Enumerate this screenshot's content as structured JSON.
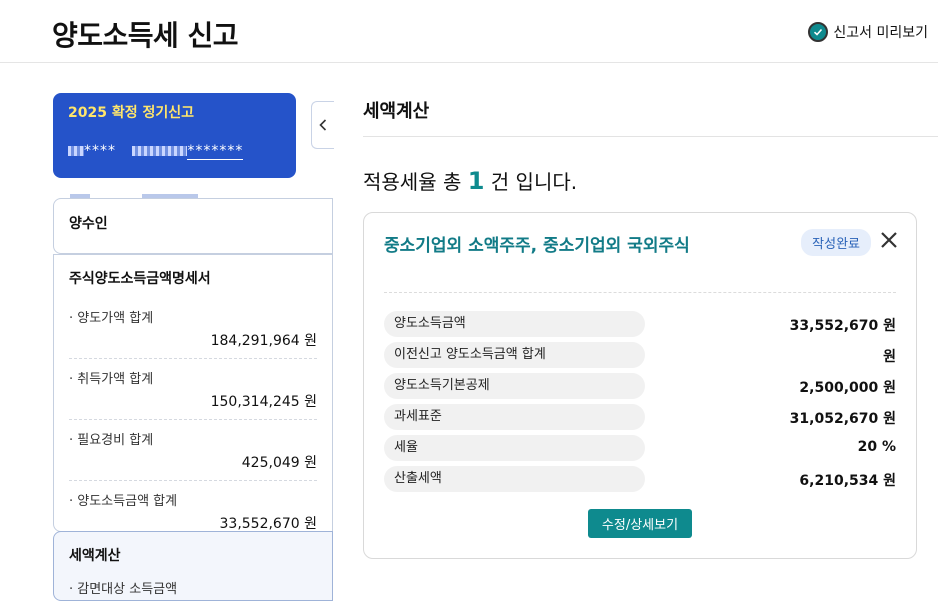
{
  "header": {
    "title": "양도소득세 신고",
    "preview_label": "신고서 미리보기"
  },
  "sidebar": {
    "card": {
      "year_label": "2025 확정 정기신고",
      "masked_left": "****",
      "masked_right": "*******"
    },
    "sections": [
      {
        "title": "양수인"
      },
      {
        "title": "주식양도소득금액명세서",
        "items": [
          {
            "label": "· 양도가액 합계",
            "value": "184,291,964 원"
          },
          {
            "label": "· 취득가액 합계",
            "value": "150,314,245 원"
          },
          {
            "label": "· 필요경비 합계",
            "value": "425,049 원"
          },
          {
            "label": "· 양도소득금액 합계",
            "value": "33,552,670 원"
          }
        ]
      },
      {
        "title": "세액계산",
        "items": [
          {
            "label": "· 감면대상 소득금액"
          }
        ]
      }
    ]
  },
  "main": {
    "title": "세액계산",
    "summary": {
      "prefix": "적용세율 총",
      "count": "1",
      "suffix": "건 입니다."
    },
    "card": {
      "heading": "중소기업외 소액주주, 중소기업외 국외주식",
      "status": "작성완료",
      "rows": [
        {
          "label": "양도소득금액",
          "value": "33,552,670 원"
        },
        {
          "label": "이전신고 양도소득금액 합계",
          "value": "원"
        },
        {
          "label": "양도소득기본공제",
          "value": "2,500,000 원"
        },
        {
          "label": "과세표준",
          "value": "31,052,670 원"
        },
        {
          "label": "세율",
          "value": "20 %"
        },
        {
          "label": "산출세액",
          "value": "6,210,534 원"
        }
      ],
      "detail_button": "수정/상세보기"
    }
  },
  "colors": {
    "accent": "#0e8a8e",
    "brand_blue": "#2553c9",
    "year_yellow": "#ffe66b"
  }
}
